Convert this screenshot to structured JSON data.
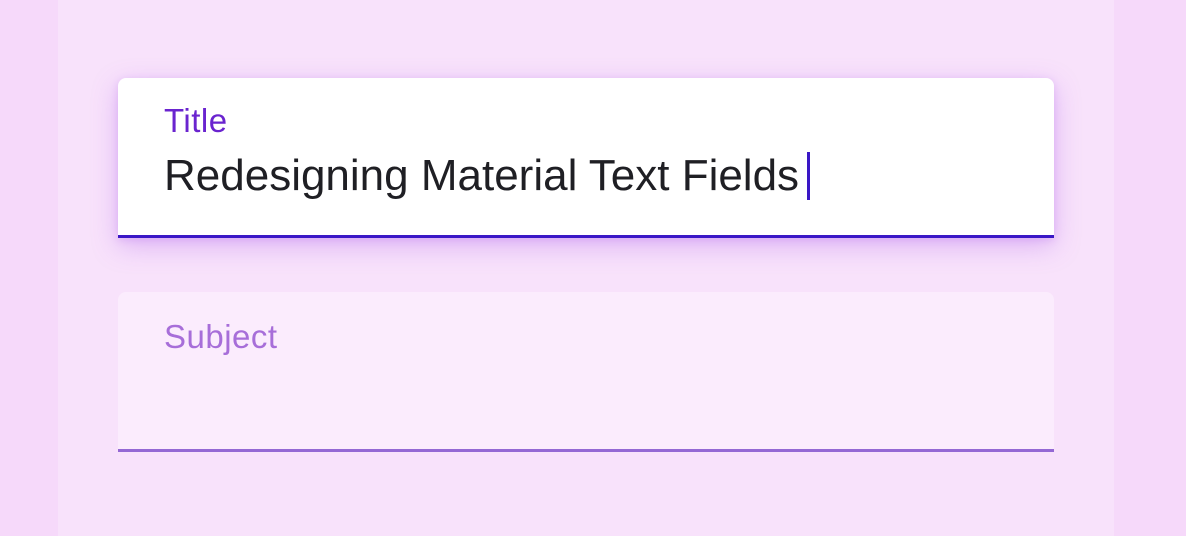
{
  "title_field": {
    "label": "Title",
    "value": "Redesigning Material Text Fields",
    "focused": true,
    "accent_color": "#3a17c6"
  },
  "subject_field": {
    "label": "Subject",
    "value": "",
    "focused": false,
    "accent_color": "#9468d4"
  }
}
